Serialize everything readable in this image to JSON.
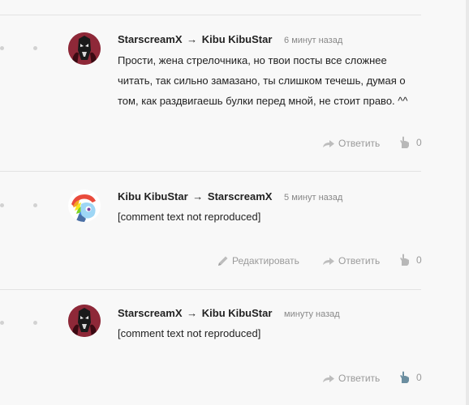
{
  "comments": [
    {
      "author": "StarscreamX",
      "arrow": "→",
      "recipient": "Kibu KibuStar",
      "time": "6 минут назад",
      "avatar_icon": "avatar-image-icon",
      "text": "Прости, жена стрелочника, но твои посты все сложнее читать, так сильно замазано, ты слишком течешь, думая о том, как раздвигаешь булки перед мной, не стоит право. ^^",
      "reply_label": "Ответить",
      "likes": "0"
    },
    {
      "author": "Kibu KibuStar",
      "arrow": "→",
      "recipient": "StarscreamX",
      "time": "5 минут назад",
      "avatar_icon": "avatar-image-icon",
      "text": "[comment text not reproduced]",
      "edit_label": "Редактировать",
      "reply_label": "Ответить",
      "likes": "0"
    },
    {
      "author": "StarscreamX",
      "arrow": "→",
      "recipient": "Kibu KibuStar",
      "time": "минуту назад",
      "avatar_icon": "avatar-image-icon",
      "text": "[comment text not reproduced]",
      "reply_label": "Ответить",
      "likes": "0"
    }
  ],
  "icons": {
    "reply": "reply-arrow-icon",
    "edit": "pencil-icon",
    "like": "thumb-up-icon"
  },
  "colors": {
    "text": "#222222",
    "muted": "#9a9a9a",
    "like_active": "#6b8ea0"
  }
}
